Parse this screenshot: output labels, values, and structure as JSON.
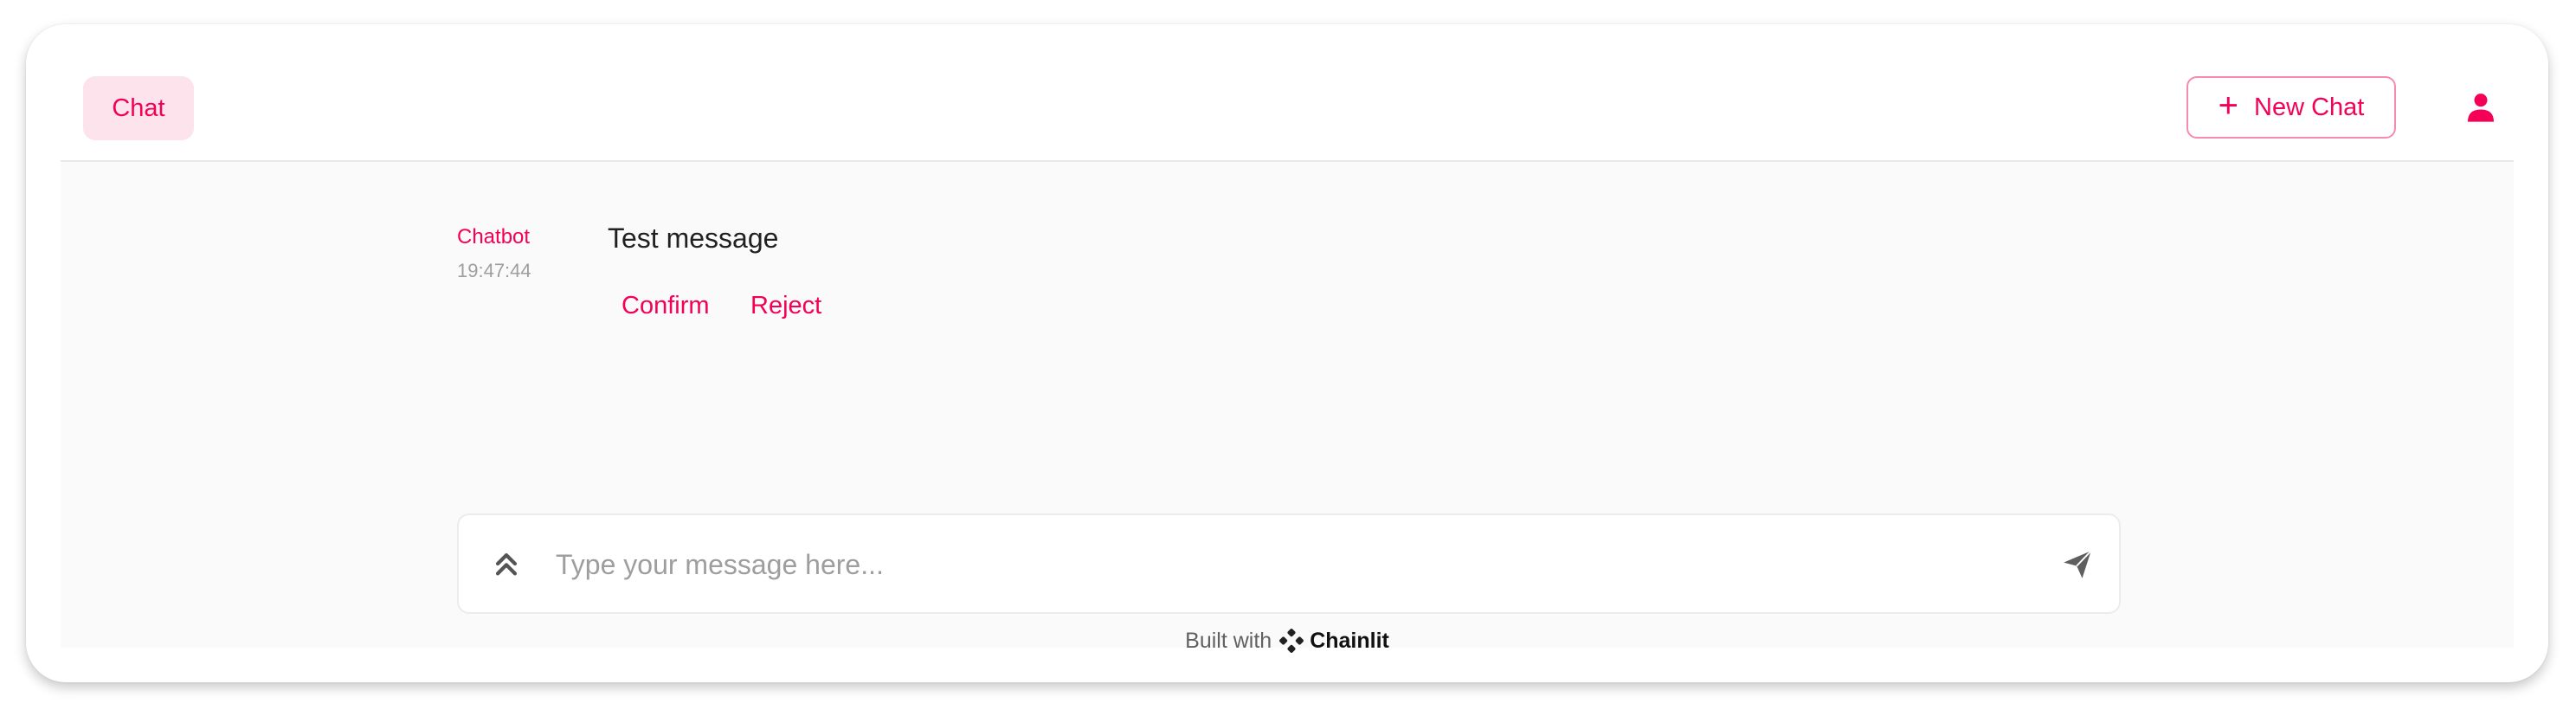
{
  "header": {
    "tab_chat_label": "Chat",
    "new_chat_label": "New Chat",
    "new_chat_icon": "plus-icon",
    "user_icon": "user-icon"
  },
  "message": {
    "author": "Chatbot",
    "timestamp": "19:47:44",
    "text": "Test message",
    "actions": [
      "Confirm",
      "Reject"
    ]
  },
  "composer": {
    "placeholder": "Type your message here...",
    "value": "",
    "left_icon": "chevrons-up-icon",
    "send_icon": "send-icon"
  },
  "footer": {
    "built_with": "Built with",
    "brand": "Chainlit"
  },
  "colors": {
    "accent": "#f50057",
    "accent_light": "#fde4ec",
    "background": "#fafafa",
    "muted_text": "#9e9e9e"
  }
}
